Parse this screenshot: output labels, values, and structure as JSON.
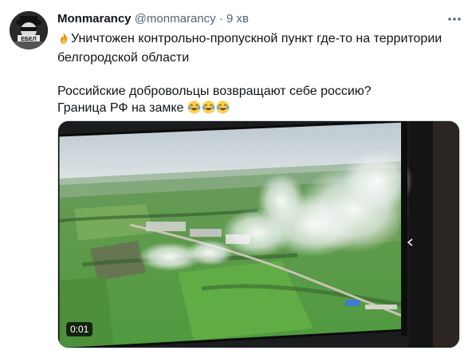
{
  "tweet": {
    "author_name": "Monmarancy",
    "author_handle": "@monmarancy",
    "separator": "·",
    "time": "9 хв",
    "line1": "Уничтожен контрольно-пропускной пункт где-то на территории белгородской области",
    "line2": "Российские добровольцы возвращают себе россию?",
    "line3": "Граница РФ на замке",
    "line1_icon": "fire-emoji",
    "line3_icons": [
      "joy-emoji",
      "joy-emoji",
      "joy-emoji"
    ]
  },
  "video": {
    "timestamp": "0:01",
    "description_icon": "aerial-smoke-video-thumbnail"
  },
  "colors": {
    "text": "#0f1419",
    "secondary_text": "#536471",
    "border": "#cfd9de"
  }
}
